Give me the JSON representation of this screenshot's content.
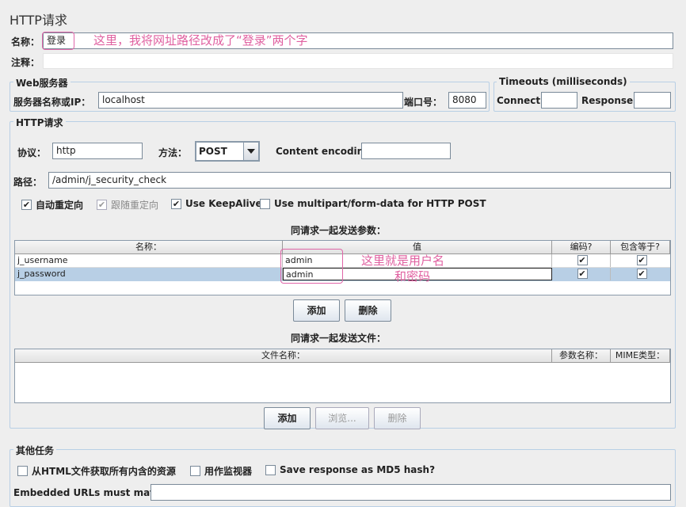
{
  "header": {
    "title": "HTTP请求"
  },
  "name_row": {
    "label": "名称：",
    "value": "登录",
    "annotation": "这里，我将网址路径改成了“登录”两个字"
  },
  "comment_row": {
    "label": "注释：",
    "value": ""
  },
  "web_server": {
    "legend": "Web服务器",
    "host_label": "服务器名称或IP：",
    "host_value": "localhost",
    "port_label": "端口号：",
    "port_value": "8080"
  },
  "timeouts": {
    "legend": "Timeouts (milliseconds)",
    "connect_label": "Connect:",
    "connect_value": "",
    "response_label": "Response:",
    "response_value": ""
  },
  "http_request": {
    "legend": "HTTP请求",
    "protocol_label": "协议：",
    "protocol_value": "http",
    "method_label": "方法：",
    "method_value": "POST",
    "encoding_label": "Content encoding:",
    "encoding_value": "",
    "path_label": "路径：",
    "path_value": "/admin/j_security_check",
    "options": [
      {
        "label": "自动重定向",
        "checked": true,
        "enabled": true
      },
      {
        "label": "跟随重定向",
        "checked": true,
        "enabled": false
      },
      {
        "label": "Use KeepAlive",
        "checked": true,
        "enabled": true
      },
      {
        "label": "Use multipart/form-data for HTTP POST",
        "checked": false,
        "enabled": true
      }
    ]
  },
  "params": {
    "caption": "同请求一起发送参数：",
    "columns": [
      "名称：",
      "值",
      "编码?",
      "包含等于?"
    ],
    "rows": [
      {
        "name": "j_username",
        "value": "admin",
        "encode": "✔",
        "include_equals": "✔"
      },
      {
        "name": "j_password",
        "value": "admin",
        "encode": "✔",
        "include_equals": "✔"
      }
    ],
    "annotation_line1": "这里就是用户名",
    "annotation_line2": "和密码",
    "add_button": "添加",
    "delete_button": "删除"
  },
  "files": {
    "caption": "同请求一起发送文件：",
    "columns": [
      "文件名称：",
      "参数名称：",
      "MIME类型："
    ],
    "add_button": "添加",
    "browse_button": "浏览...",
    "delete_button": "删除"
  },
  "other_tasks": {
    "legend": "其他任务",
    "options": [
      {
        "label": "从HTML文件获取所有内含的资源",
        "checked": false
      },
      {
        "label": "用作监视器",
        "checked": false
      },
      {
        "label": "Save response as MD5 hash?",
        "checked": false
      }
    ],
    "embedded_label": "Embedded URLs must match:",
    "embedded_value": ""
  },
  "colors": {
    "annotation": "#e060a0",
    "selection": "#b8cfe5",
    "border": "#b8cfe5"
  }
}
